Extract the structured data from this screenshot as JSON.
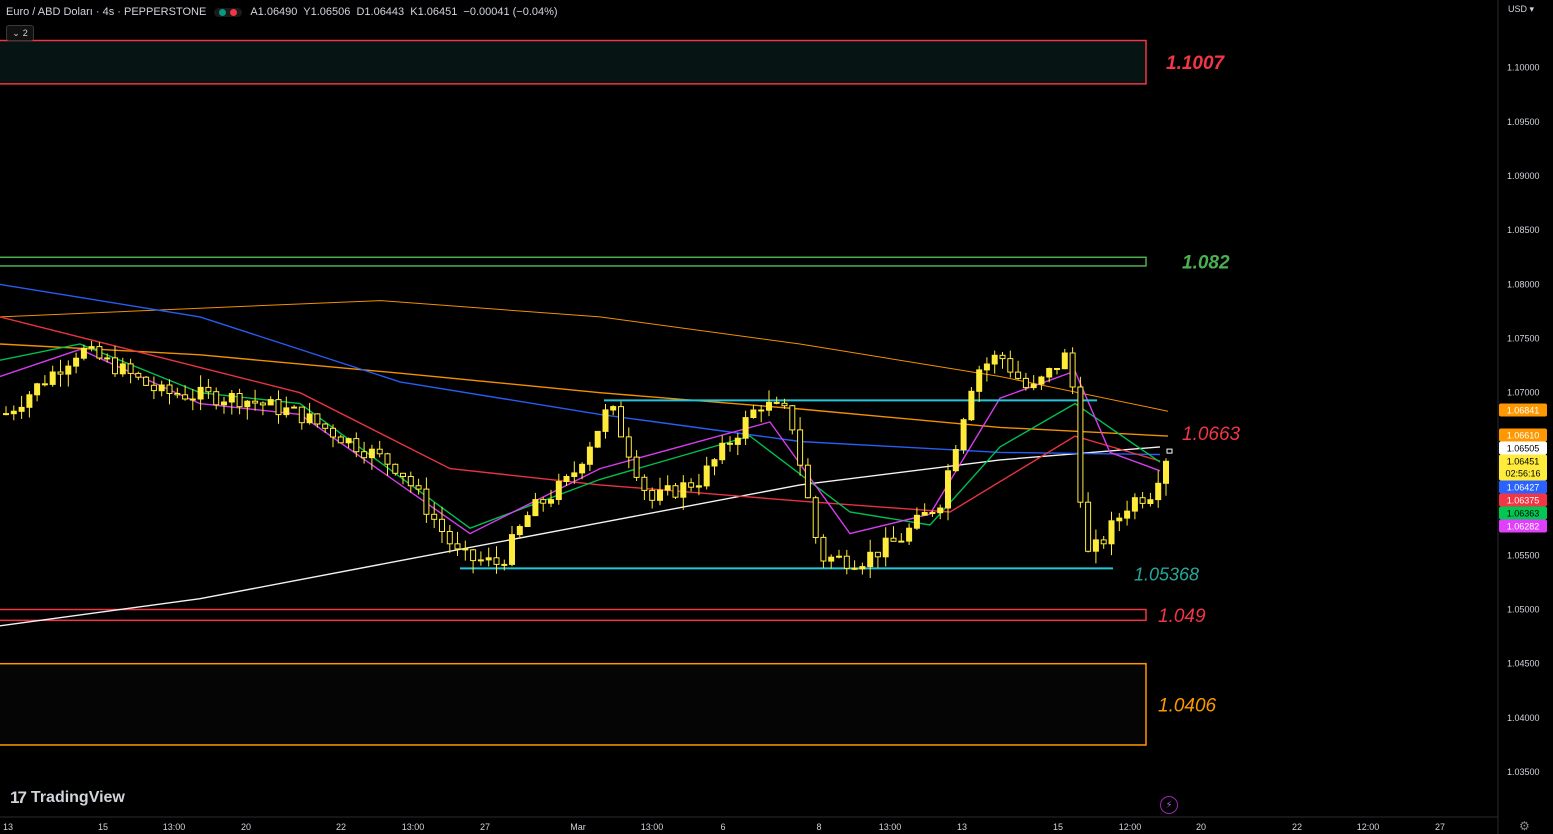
{
  "header": {
    "symbol": "Euro / ABD Doları · 4s · PEPPERSTONE",
    "open": "A1.06490",
    "high": "Y1.06506",
    "low": "D1.06443",
    "close": "K1.06451",
    "change": "−0.00041 (−0.04%)",
    "indicator_count": "2"
  },
  "currency": "USD",
  "brand": "TradingView",
  "icons": [
    "chevron-down-icon",
    "lightning-icon",
    "gear-icon",
    "tradingview-logo-icon"
  ],
  "colors": {
    "background": "#000000",
    "candle": "#ffeb3b",
    "zone_red": "#f23645",
    "zone_green": "#4caf50",
    "zone_orange": "#ff9800",
    "channel": "#26c6da"
  },
  "chart_data": {
    "type": "candlestick",
    "ylim": [
      1.0315,
      1.1055
    ],
    "y_ticks": [
      "1.10000",
      "1.09500",
      "1.09000",
      "1.08500",
      "1.08000",
      "1.07500",
      "1.07000",
      "1.06500",
      "1.06000",
      "1.05500",
      "1.05000",
      "1.04500",
      "1.04000",
      "1.03500"
    ],
    "x_ticks": [
      "13",
      "15",
      "13:00",
      "20",
      "22",
      "13:00",
      "27",
      "Mar",
      "13:00",
      "6",
      "8",
      "13:00",
      "13",
      "15",
      "12:00",
      "20",
      "22",
      "12:00",
      "27"
    ],
    "zones": [
      {
        "label": "1.1007",
        "top": 1.1025,
        "bottom": 1.0985,
        "color": "#f23645",
        "fill": "#061414"
      },
      {
        "label": "1.082",
        "top": 1.0825,
        "bottom": 1.0817,
        "color": "#4caf50",
        "fill": "#000000"
      },
      {
        "label": "1.049",
        "top": 1.05,
        "bottom": 1.049,
        "color": "#f23645",
        "fill": "#000000"
      },
      {
        "label": "1.0406",
        "top": 1.045,
        "bottom": 1.0375,
        "color": "#ff9800",
        "fill": "#050505"
      }
    ],
    "lines": [
      {
        "label": "",
        "value": 1.0693,
        "color": "#26c6da"
      },
      {
        "label": "1.05368",
        "value": 1.0538,
        "color": "#26c6da"
      }
    ],
    "line_labels": [
      {
        "text": "1.0663",
        "value": 1.0663,
        "color": "#f23645"
      }
    ],
    "price_tags": [
      {
        "text": "1.06841",
        "value": 1.06841,
        "color": "#ff9800"
      },
      {
        "text": "1.06610",
        "value": 1.0661,
        "color": "#ff9800"
      },
      {
        "text": "1.06505",
        "value": 1.06505,
        "color": "#ffffff"
      },
      {
        "text": "1.06451",
        "sub": "02:56:16",
        "value": 1.06451,
        "color": "#ffeb3b"
      },
      {
        "text": "1.06427",
        "value": 1.06427,
        "color": "#2962ff"
      },
      {
        "text": "1.06375",
        "value": 1.06375,
        "color": "#f23645"
      },
      {
        "text": "1.06363",
        "value": 1.06363,
        "color": "#00c853"
      },
      {
        "text": "1.06282",
        "value": 1.06282,
        "color": "#e040fb"
      }
    ],
    "moving_averages": [
      {
        "color": "#ffffff",
        "points": [
          [
            0,
            1.0485
          ],
          [
            200,
            1.051
          ],
          [
            400,
            1.0545
          ],
          [
            600,
            1.058
          ],
          [
            800,
            1.0615
          ],
          [
            1000,
            1.0638
          ],
          [
            1160,
            1.065
          ]
        ]
      },
      {
        "color": "#ff9800",
        "points": [
          [
            0,
            1.077
          ],
          [
            200,
            1.0778
          ],
          [
            380,
            1.0785
          ],
          [
            600,
            1.077
          ],
          [
            800,
            1.0745
          ],
          [
            1000,
            1.0715
          ],
          [
            1168,
            1.0683
          ]
        ]
      },
      {
        "color": "#ff9800",
        "points": [
          [
            0,
            1.0745
          ],
          [
            200,
            1.0735
          ],
          [
            400,
            1.0718
          ],
          [
            600,
            1.07
          ],
          [
            800,
            1.0685
          ],
          [
            1000,
            1.0668
          ],
          [
            1168,
            1.066
          ]
        ]
      },
      {
        "color": "#2962ff",
        "points": [
          [
            0,
            1.08
          ],
          [
            200,
            1.077
          ],
          [
            400,
            1.071
          ],
          [
            600,
            1.068
          ],
          [
            800,
            1.0655
          ],
          [
            1000,
            1.0645
          ],
          [
            1160,
            1.0643
          ]
        ]
      },
      {
        "color": "#f23645",
        "points": [
          [
            0,
            1.077
          ],
          [
            150,
            1.0735
          ],
          [
            300,
            1.07
          ],
          [
            450,
            1.063
          ],
          [
            600,
            1.0615
          ],
          [
            800,
            1.06
          ],
          [
            950,
            1.059
          ],
          [
            1075,
            1.066
          ],
          [
            1160,
            1.0637
          ]
        ]
      },
      {
        "color": "#00c853",
        "points": [
          [
            0,
            1.073
          ],
          [
            80,
            1.0745
          ],
          [
            200,
            1.07
          ],
          [
            300,
            1.069
          ],
          [
            470,
            1.0575
          ],
          [
            600,
            1.062
          ],
          [
            750,
            1.066
          ],
          [
            850,
            1.059
          ],
          [
            930,
            1.0578
          ],
          [
            1000,
            1.065
          ],
          [
            1075,
            1.069
          ],
          [
            1160,
            1.0636
          ]
        ]
      },
      {
        "color": "#e040fb",
        "points": [
          [
            0,
            1.0715
          ],
          [
            80,
            1.074
          ],
          [
            200,
            1.069
          ],
          [
            300,
            1.068
          ],
          [
            470,
            1.057
          ],
          [
            600,
            1.063
          ],
          [
            770,
            1.0673
          ],
          [
            850,
            1.057
          ],
          [
            930,
            1.0588
          ],
          [
            1000,
            1.0695
          ],
          [
            1075,
            1.072
          ],
          [
            1110,
            1.0645
          ],
          [
            1160,
            1.0628
          ]
        ]
      }
    ],
    "candles_path": [
      [
        0,
        1.0676
      ],
      [
        80,
        1.074
      ],
      [
        120,
        1.0722
      ],
      [
        160,
        1.07
      ],
      [
        240,
        1.0695
      ],
      [
        300,
        1.068
      ],
      [
        400,
        1.063
      ],
      [
        460,
        1.0548
      ],
      [
        500,
        1.0542
      ],
      [
        530,
        1.059
      ],
      [
        570,
        1.062
      ],
      [
        610,
        1.0688
      ],
      [
        650,
        1.06
      ],
      [
        700,
        1.062
      ],
      [
        760,
        1.069
      ],
      [
        790,
        1.068
      ],
      [
        820,
        1.0548
      ],
      [
        860,
        1.0545
      ],
      [
        900,
        1.0565
      ],
      [
        940,
        1.06
      ],
      [
        975,
        1.072
      ],
      [
        1000,
        1.0735
      ],
      [
        1030,
        1.07
      ],
      [
        1070,
        1.0738
      ],
      [
        1085,
        1.0548
      ],
      [
        1100,
        1.056
      ],
      [
        1130,
        1.06
      ],
      [
        1150,
        1.0607
      ],
      [
        1168,
        1.0645
      ]
    ],
    "candle_count": 150,
    "candle_x_start": 6,
    "candle_x_end": 1166
  }
}
